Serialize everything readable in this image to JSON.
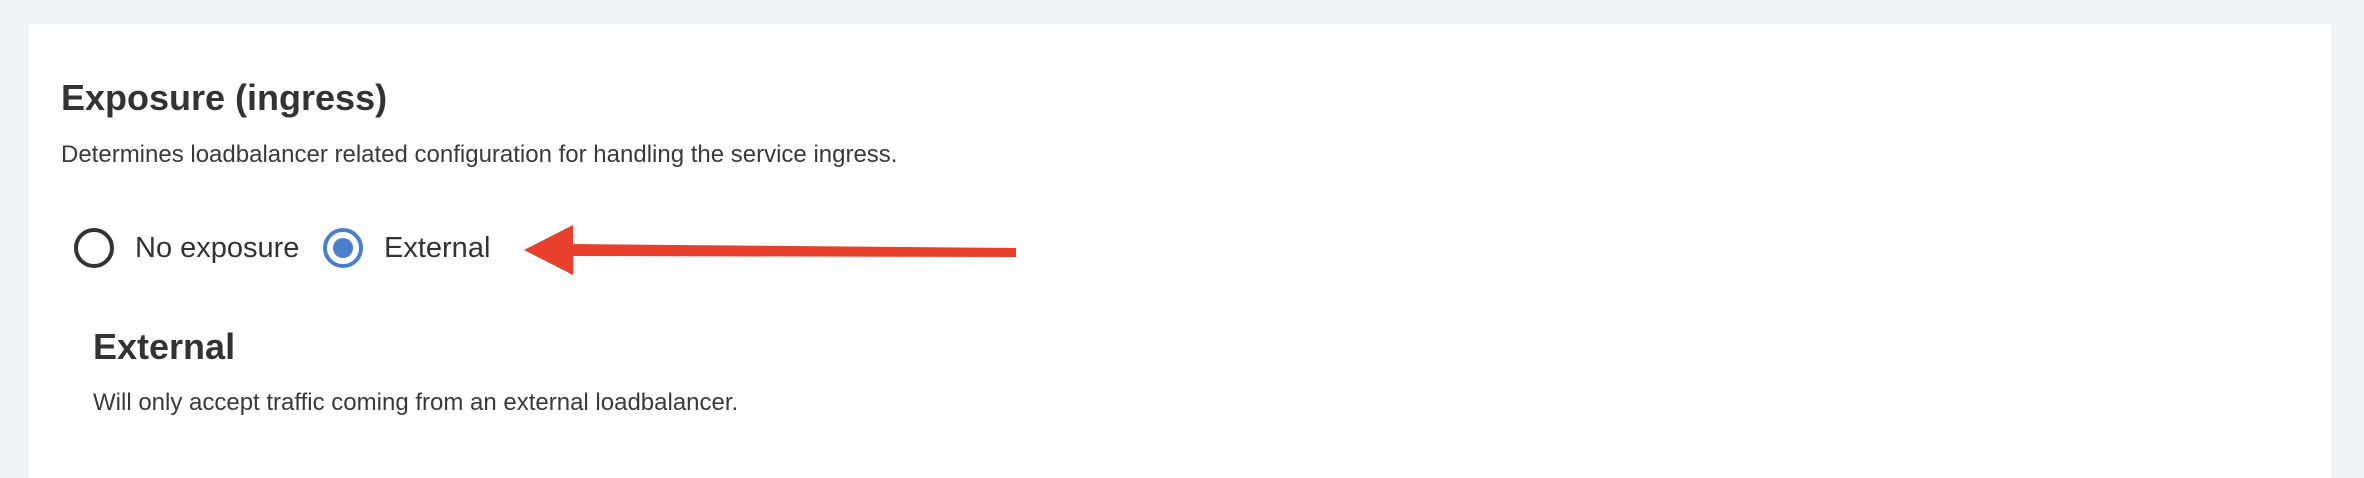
{
  "section": {
    "title": "Exposure (ingress)",
    "description": "Determines loadbalancer related configuration for handling the service ingress."
  },
  "exposure_options": [
    {
      "label": "No exposure",
      "selected": false
    },
    {
      "label": "External",
      "selected": true
    }
  ],
  "selected_detail": {
    "title": "External",
    "description": "Will only accept traffic coming from an external loadbalancer."
  },
  "colors": {
    "accent": "#4a7fd0",
    "annotation_arrow": "#e8402a",
    "text": "#333333",
    "page_background": "#f3f4f6",
    "panel_background": "#ffffff"
  }
}
